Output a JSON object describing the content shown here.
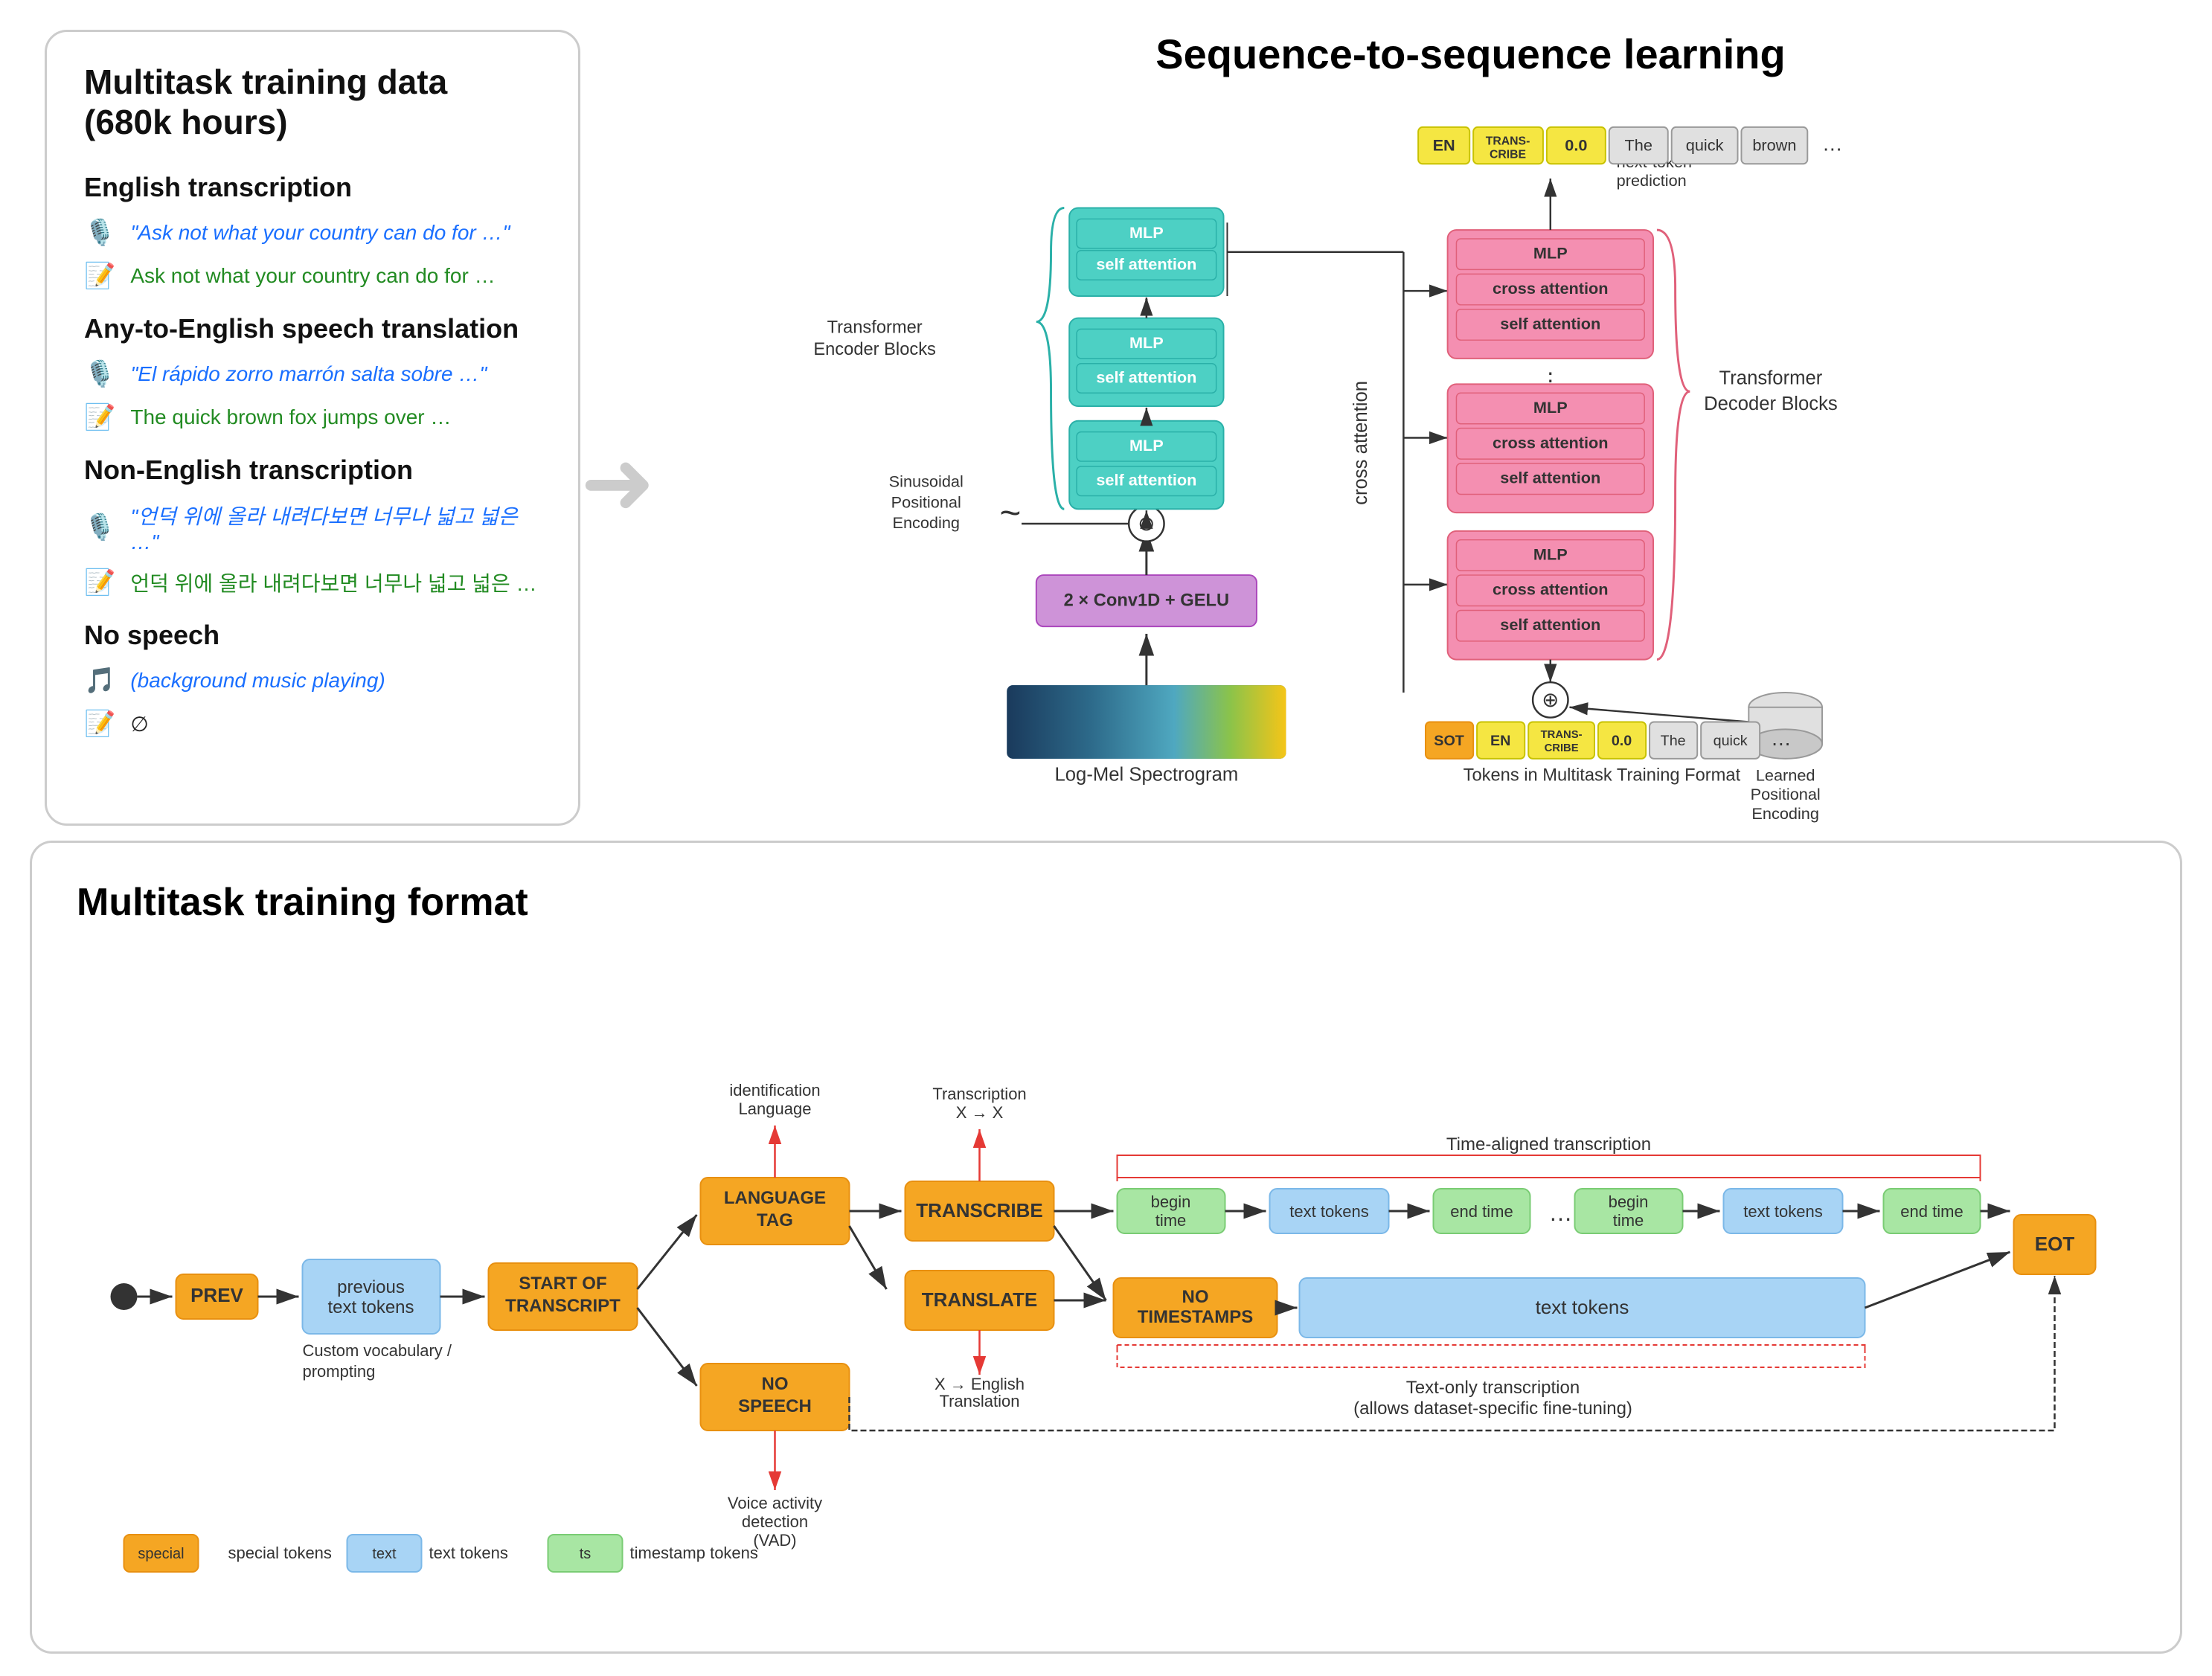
{
  "top_left": {
    "title": "Multitask training data (680k hours)",
    "sections": [
      {
        "heading": "English transcription",
        "items": [
          {
            "icon": "🎙️",
            "text": "\"Ask not what your country can do for …\"",
            "style": "blue"
          },
          {
            "icon": "📝",
            "text": "Ask not what your country can do for …",
            "style": "green"
          }
        ]
      },
      {
        "heading": "Any-to-English speech translation",
        "items": [
          {
            "icon": "🎙️",
            "text": "\"El rápido zorro marrón salta sobre …\"",
            "style": "blue"
          },
          {
            "icon": "📝",
            "text": "The quick brown fox jumps over …",
            "style": "green"
          }
        ]
      },
      {
        "heading": "Non-English transcription",
        "items": [
          {
            "icon": "🎙️",
            "text": "\"언덕 위에 올라 내려다보면 너무나 넓고 넓은 …\"",
            "style": "blue"
          },
          {
            "icon": "📝",
            "text": "언덕 위에 올라 내려다보면 너무나 넓고 넓은 …",
            "style": "green"
          }
        ]
      },
      {
        "heading": "No speech",
        "items": [
          {
            "icon": "🎵",
            "text": "(background music playing)",
            "style": "blue"
          },
          {
            "icon": "📝",
            "text": "∅",
            "style": "black"
          }
        ]
      }
    ]
  },
  "seq2seq": {
    "title": "Sequence-to-sequence learning"
  },
  "encoder": {
    "label": "Transformer\nEncoder Blocks",
    "blocks": [
      {
        "inner": [
          "MLP",
          "self attention"
        ]
      },
      {
        "inner": [
          "MLP",
          "self attention"
        ]
      },
      {
        "inner": [
          "MLP",
          "self attention"
        ]
      }
    ],
    "pos_encoding": "Sinusoidal\nPositional\nEncoding",
    "conv": "2 × Conv1D + GELU",
    "spectrogram": "Log-Mel Spectrogram"
  },
  "decoder": {
    "label": "Transformer\nDecoder Blocks",
    "blocks": [
      {
        "inner": [
          "MLP",
          "cross attention",
          "self attention"
        ]
      },
      {
        "inner": [
          "MLP",
          "cross attention",
          "self attention"
        ]
      },
      {
        "inner": [
          "MLP",
          "cross attention",
          "self attention"
        ]
      }
    ],
    "pos_encoding": "Learned\nPositional\nEncoding",
    "cross_attention": "cross\nattention"
  },
  "output_tokens": [
    "EN",
    "TRANS-\nCRIBE",
    "0.0",
    "The",
    "quick",
    "brown",
    "…"
  ],
  "output_token_colors": [
    "yellow",
    "yellow",
    "yellow",
    "white",
    "white",
    "white",
    "white"
  ],
  "input_tokens": [
    "SOT",
    "EN",
    "TRANS-\nCRIBE",
    "0.0",
    "The",
    "quick",
    "…"
  ],
  "next_token_label": "next-token\nprediction",
  "tokens_label": "Tokens in Multitask Training Format",
  "bottom": {
    "title": "Multitask training format",
    "nodes": {
      "prev": "PREV",
      "previous_text": "previous\ntext tokens",
      "start_of_transcript": "START OF\nTRANSCRIPT",
      "language_tag": "LANGUAGE\nTAG",
      "no_speech": "NO\nSPEECH",
      "transcribe": "TRANSCRIBE",
      "translate": "TRANSLATE",
      "no_timestamps": "NO\nTIMESTAMPS",
      "begin_time": "begin\ntime",
      "text_tokens": "text tokens",
      "end_time": "end time",
      "begin_time2": "begin\ntime",
      "text_tokens2": "text tokens",
      "end_time2": "end time",
      "text_tokens_long": "text tokens",
      "eot": "EOT"
    },
    "labels": {
      "custom_vocab": "Custom vocabulary /\nprompting",
      "language_id": "Language\nidentification",
      "voice_activity": "Voice activity\ndetection\n(VAD)",
      "x_to_x": "X → X\nTranscription",
      "x_to_english": "X → English\nTranslation",
      "time_aligned": "Time-aligned transcription",
      "text_only": "Text-only transcription\n(allows dataset-specific fine-tuning)"
    },
    "legend": [
      {
        "label": "special tokens",
        "color": "#f5a623"
      },
      {
        "label": "text tokens",
        "color": "#a8d4f5"
      },
      {
        "label": "timestamp tokens",
        "color": "#a8e6a3"
      }
    ]
  }
}
